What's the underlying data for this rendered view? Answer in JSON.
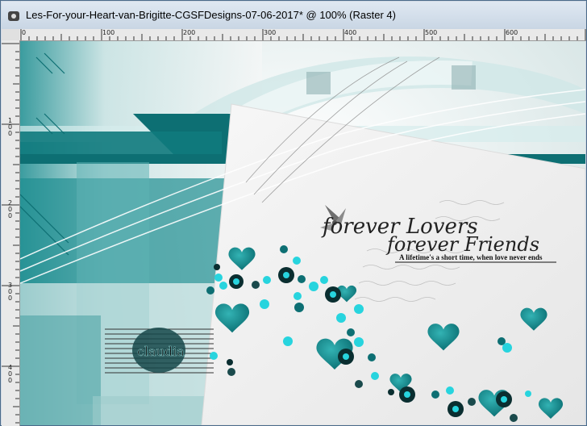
{
  "window": {
    "title": "Les-For-your-Heart-van-Brigitte-CGSFDesigns-07-06-2017* @ 100% (Raster 4)"
  },
  "ruler": {
    "top_labels": [
      "0",
      "100",
      "200",
      "300",
      "400",
      "500",
      "600"
    ],
    "left_labels": [
      "1\n0\n0",
      "2\n0\n0",
      "3\n0\n0",
      "4\n0\n0"
    ]
  },
  "artwork": {
    "title_line1": "forever Lovers",
    "title_line2": "forever Friends",
    "tagline": "A lifetime's a short time, when love never ends",
    "stamp": "claudia"
  },
  "colors": {
    "teal_dark": "#0d6f73",
    "teal": "#149a9c",
    "teal_light": "#7fc6c6",
    "cyan": "#27d4de",
    "paper": "#f2f2f2"
  }
}
